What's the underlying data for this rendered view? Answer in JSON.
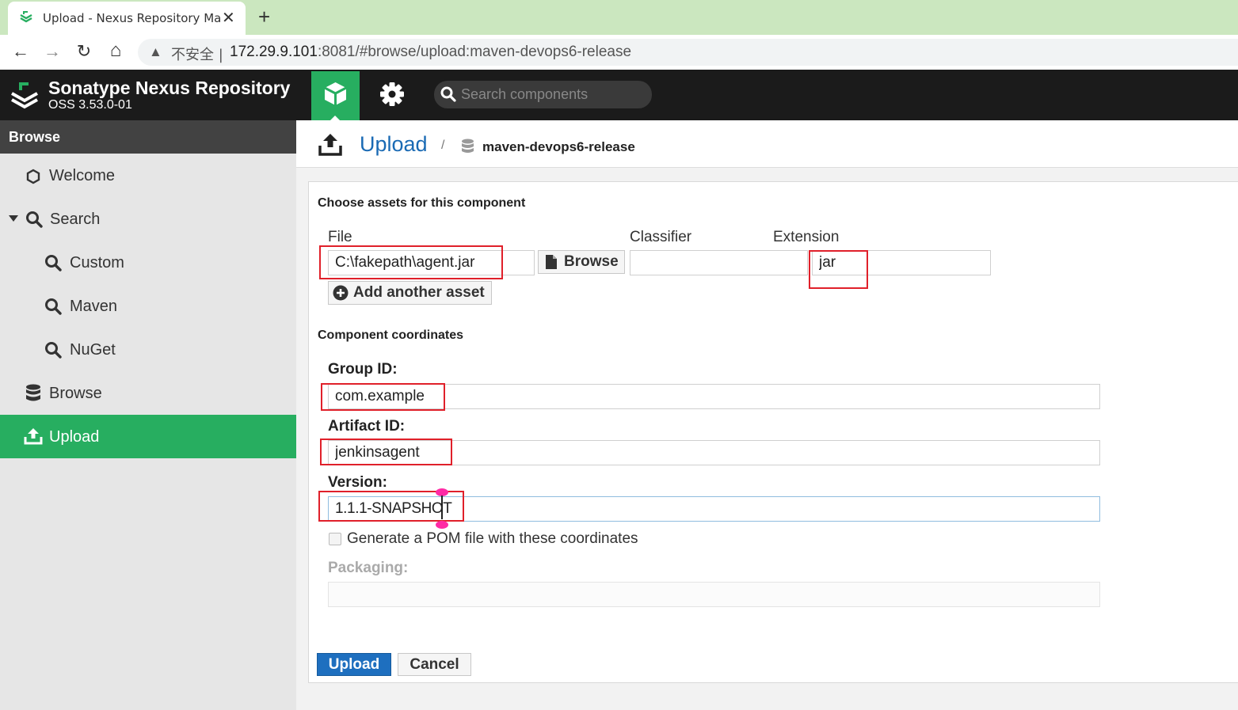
{
  "browser": {
    "tab_title": "Upload - Nexus Repository Ma",
    "close_glyph": "✕",
    "new_tab_glyph": "+",
    "back_glyph": "←",
    "forward_glyph": "→",
    "reload_glyph": "↻",
    "home_glyph": "⌂",
    "warning_glyph": "▲",
    "insecure_label": "不安全 |",
    "url_host": "172.29.9.101",
    "url_rest": ":8081/#browse/upload:maven-devops6-release"
  },
  "header": {
    "title": "Sonatype Nexus Repository",
    "version": "OSS 3.53.0-01",
    "search_placeholder": "Search components"
  },
  "sidebar": {
    "heading": "Browse",
    "items": [
      {
        "label": "Welcome"
      },
      {
        "label": "Search"
      },
      {
        "label": "Custom"
      },
      {
        "label": "Maven"
      },
      {
        "label": "NuGet"
      },
      {
        "label": "Browse"
      },
      {
        "label": "Upload"
      }
    ]
  },
  "breadcrumb": {
    "title": "Upload",
    "separator": "/",
    "repository": "maven-devops6-release"
  },
  "form": {
    "assets_heading": "Choose assets for this component",
    "file_label": "File",
    "file_value": "C:\\fakepath\\agent.jar",
    "browse_label": "Browse",
    "classifier_label": "Classifier",
    "classifier_value": "",
    "extension_label": "Extension",
    "extension_value": "jar",
    "add_asset_label": "Add another asset",
    "coords_heading": "Component coordinates",
    "group_label": "Group ID:",
    "group_value": "com.example",
    "artifact_label": "Artifact ID:",
    "artifact_value": "jenkinsagent",
    "version_label": "Version:",
    "version_value": "1.1.1-SNAPSHOT",
    "pom_label": "Generate a POM file with these coordinates",
    "packaging_label": "Packaging:",
    "packaging_value": "",
    "upload_label": "Upload",
    "cancel_label": "Cancel"
  },
  "colors": {
    "accent_green": "#27ae60",
    "header_dark": "#1b1b1b",
    "link_blue": "#1a6ab4",
    "annotation_red": "#e0202a"
  }
}
